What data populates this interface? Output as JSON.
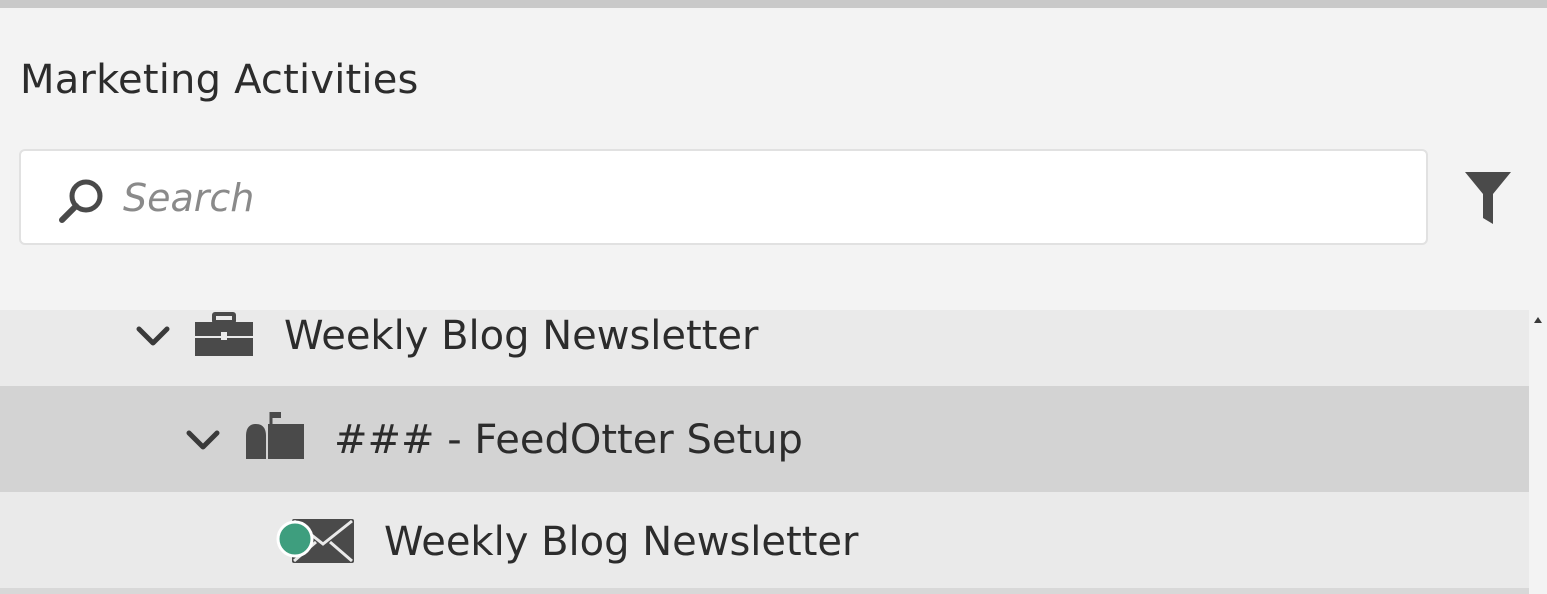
{
  "panel": {
    "title": "Marketing Activities"
  },
  "search": {
    "placeholder": "Search",
    "value": ""
  },
  "icons": {
    "search": "search-icon",
    "filter": "filter-icon",
    "expand": "chevron-down-icon",
    "program": "briefcase-icon",
    "campaign_folder": "mailbox-icon",
    "email": "envelope-icon"
  },
  "colors": {
    "background": "#f3f3f3",
    "selected_row": "#d3d3d3",
    "row": "#eaeaea",
    "status_active": "#3e9e7e",
    "icon": "#4a4a4a"
  },
  "tree": {
    "items": [
      {
        "label": "Weekly Blog Newsletter",
        "type": "program",
        "expanded": true
      },
      {
        "label": "### - FeedOtter Setup",
        "type": "folder",
        "expanded": true,
        "selected": true
      },
      {
        "label": "Weekly Blog Newsletter",
        "type": "email",
        "status": "active"
      }
    ]
  }
}
